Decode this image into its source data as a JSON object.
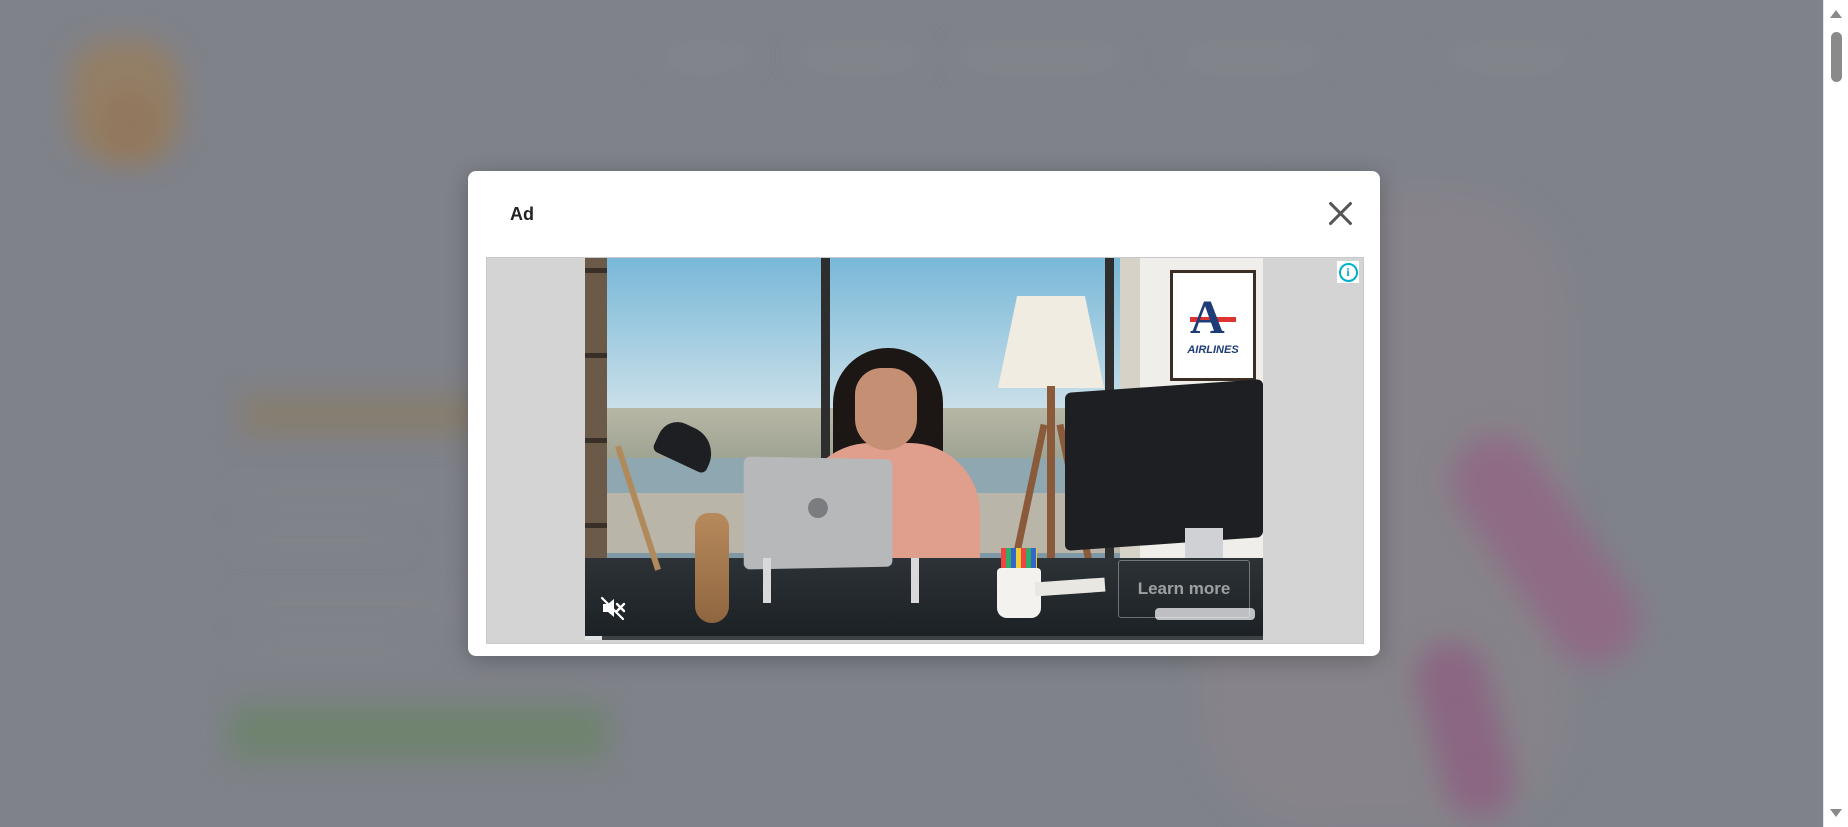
{
  "modal": {
    "title": "Ad"
  },
  "ad": {
    "poster_text": "AIRLINES",
    "learn_more_label": "Learn more",
    "video_progress": 0.025
  },
  "icons": {
    "close": "close-icon",
    "info": "info-icon",
    "mute": "speaker-muted-icon",
    "scroll_up": "scroll-up-arrow-icon",
    "scroll_down": "scroll-down-arrow-icon"
  },
  "colors": {
    "info_accent": "#00aecd",
    "overlay": "#7d8086"
  }
}
